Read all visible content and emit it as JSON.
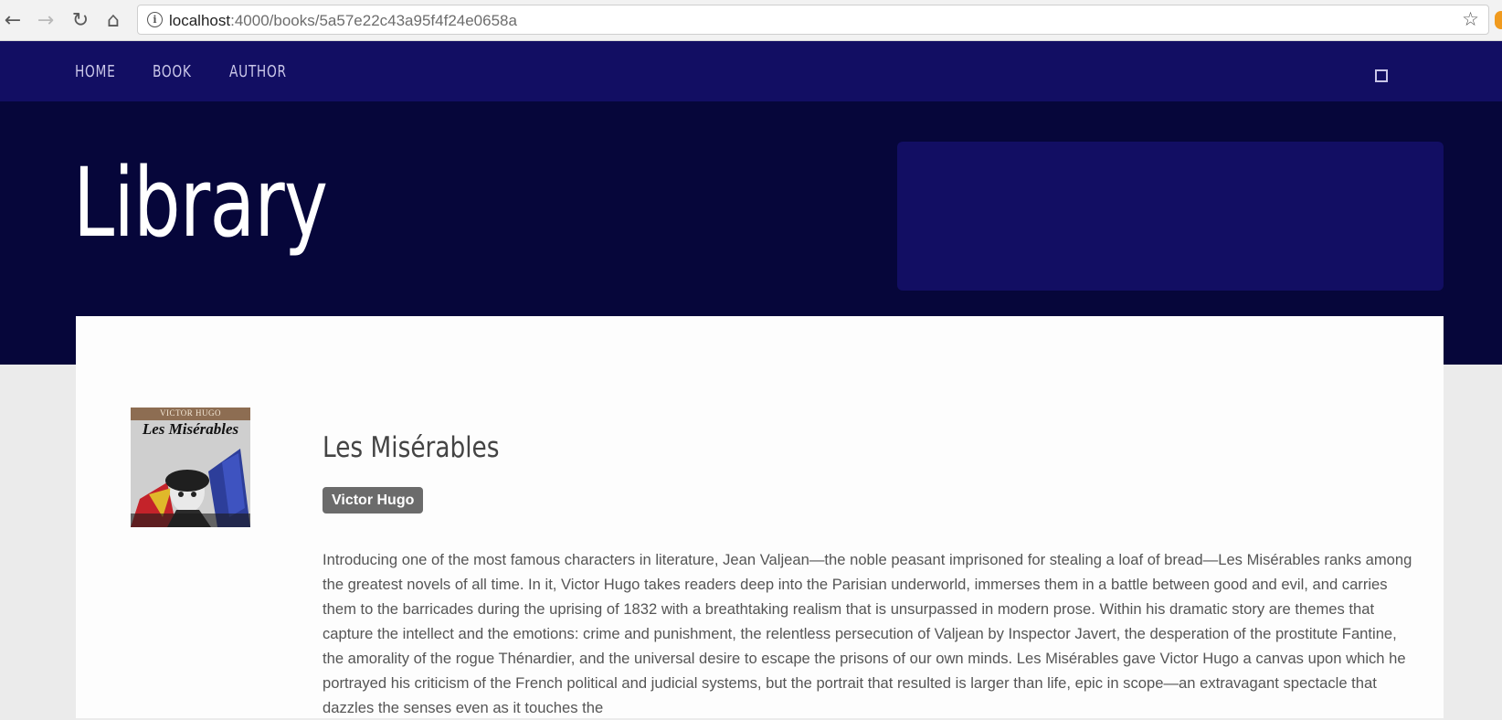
{
  "browser": {
    "url_host": "localhost",
    "url_path": ":4000/books/5a57e22c43a95f4f24e0658a",
    "back_icon": "arrow-left-icon",
    "forward_icon": "arrow-right-icon",
    "reload_icon": "reload-icon",
    "home_icon": "home-icon",
    "info_icon": "info-icon",
    "bookmark_icon": "star-icon"
  },
  "nav": {
    "items": [
      {
        "label": "HOME"
      },
      {
        "label": "BOOK"
      },
      {
        "label": "AUTHOR"
      }
    ]
  },
  "hero": {
    "title": "Library"
  },
  "book": {
    "cover_author": "VICTOR HUGO",
    "cover_title": "Les Misérables",
    "title": "Les Misérables",
    "author": "Victor Hugo",
    "description": "Introducing one of the most famous characters in literature, Jean Valjean—the noble peasant imprisoned for stealing a loaf of bread—Les Misérables ranks among the greatest novels of all time. In it, Victor Hugo takes readers deep into the Parisian underworld, immerses them in a battle between good and evil, and carries them to the barricades during the uprising of 1832 with a breathtaking realism that is unsurpassed in modern prose. Within his dramatic story are themes that capture the intellect and the emotions: crime and punishment, the relentless persecution of Valjean by Inspector Javert, the desperation of the prostitute Fantine, the amorality of the rogue Thénardier, and the universal desire to escape the prisons of our own minds. Les Misérables gave Victor Hugo a canvas upon which he portrayed his criticism of the French political and judicial systems, but the portrait that resulted is larger than life, epic in scope—an extravagant spectacle that dazzles the senses even as it touches the"
  },
  "colors": {
    "nav_bg": "#120e63",
    "hero_bg": "#06063a",
    "badge_bg": "#6b6b6b"
  }
}
